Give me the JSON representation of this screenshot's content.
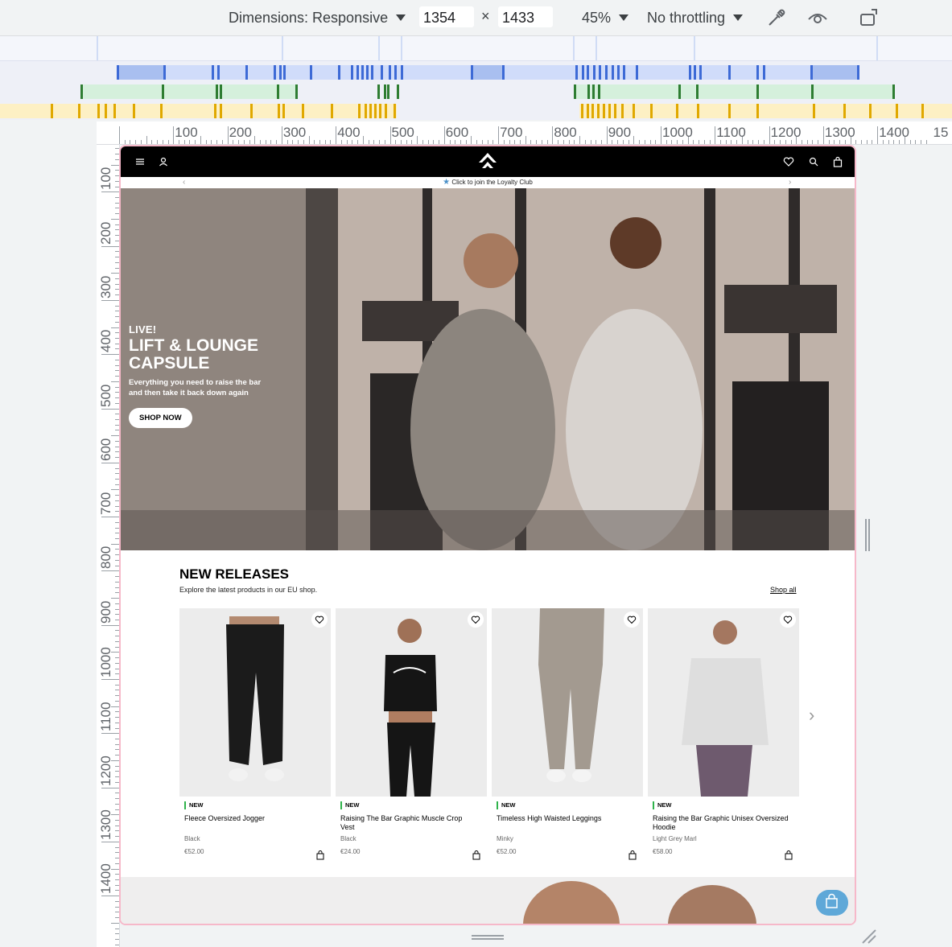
{
  "devtools": {
    "dimensions_label": "Dimensions: Responsive",
    "width_value": "1354",
    "times": "×",
    "height_value": "1433",
    "zoom": "45%",
    "throttling": "No throttling",
    "icons": [
      "eyedropper-icon",
      "eye-icon",
      "rotate-device-icon"
    ]
  },
  "ruler": {
    "h_labels": [
      "100",
      "200",
      "300",
      "400",
      "500",
      "600",
      "700",
      "800",
      "900",
      "1000",
      "1100",
      "1200",
      "1300",
      "1400",
      "15"
    ],
    "v_labels": [
      "100",
      "200",
      "300",
      "400",
      "500",
      "600",
      "700",
      "800",
      "900",
      "1000",
      "1100",
      "1200",
      "1300",
      "1400"
    ]
  },
  "site": {
    "header_icons": [
      "menu-icon",
      "account-icon",
      "logo-icon",
      "wishlist-icon",
      "search-icon",
      "bag-icon"
    ],
    "announcement": "Click to join the Loyalty Club",
    "hero": {
      "eyebrow": "LIVE!",
      "title": "LIFT & LOUNGE CAPSULE",
      "subtitle": "Everything you need to raise the bar and then take it back down again",
      "cta": "SHOP NOW"
    },
    "releases": {
      "title": "NEW RELEASES",
      "subtitle": "Explore the latest products in our EU shop.",
      "shop_all": "Shop all",
      "products": [
        {
          "badge": "NEW",
          "name": "Fleece Oversized Jogger",
          "color": "Black",
          "price": "€52.00"
        },
        {
          "badge": "NEW",
          "name": "Raising The Bar Graphic Muscle Crop Vest",
          "color": "Black",
          "price": "€24.00"
        },
        {
          "badge": "NEW",
          "name": "Timeless High Waisted Leggings",
          "color": "Minky",
          "price": "€52.00"
        },
        {
          "badge": "NEW",
          "name": "Raising the Bar Graphic Unisex Oversized Hoodie",
          "color": "Light Grey Marl",
          "price": "€58.00"
        }
      ]
    },
    "colors": {
      "badge_green": "#2fb34b",
      "chat_blue": "#5fa8d8",
      "viewport_border": "#f6b8c9"
    }
  }
}
